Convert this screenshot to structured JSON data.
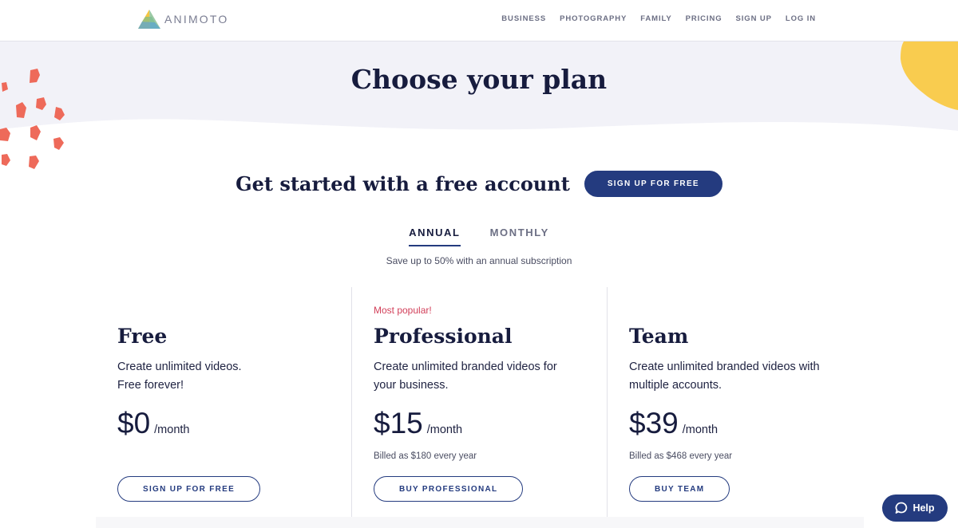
{
  "header": {
    "logo_text": "ANIMOTO",
    "nav": [
      {
        "label": "BUSINESS"
      },
      {
        "label": "PHOTOGRAPHY"
      },
      {
        "label": "FAMILY"
      },
      {
        "label": "PRICING"
      },
      {
        "label": "SIGN UP"
      },
      {
        "label": "LOG IN"
      }
    ]
  },
  "hero": {
    "title": "Choose your plan"
  },
  "free_cta": {
    "heading": "Get started with a free account",
    "button_label": "SIGN UP FOR FREE"
  },
  "billing_toggle": {
    "tabs": [
      {
        "label": "ANNUAL",
        "active": true
      },
      {
        "label": "MONTHLY",
        "active": false
      }
    ],
    "note": "Save up to 50% with an annual subscription"
  },
  "plans": [
    {
      "name": "Free",
      "description_lines": [
        "Create unlimited videos.",
        "Free forever!"
      ],
      "price": "$0",
      "unit": "/month",
      "billed": "",
      "button_label": "SIGN UP FOR FREE"
    },
    {
      "badge": "Most popular!",
      "name": "Professional",
      "description_lines": [
        "Create unlimited branded videos for",
        "your business."
      ],
      "price": "$15",
      "unit": "/month",
      "billed": "Billed as $180 every year",
      "button_label": "BUY PROFESSIONAL"
    },
    {
      "name": "Team",
      "description_lines": [
        "Create unlimited branded videos with",
        "multiple accounts."
      ],
      "price": "$39",
      "unit": "/month",
      "billed": "Billed as $468 every year",
      "button_label": "BUY TEAM"
    }
  ],
  "help": {
    "label": "Help",
    "icon": "chat-bubble-icon"
  },
  "colors": {
    "brand_navy": "#243b7f",
    "heading_navy": "#171c3e",
    "popular_red": "#d2405a",
    "hero_band": "#f2f2f8",
    "decor_coral": "#ee6a5a",
    "decor_yellow": "#f9cc4f"
  }
}
